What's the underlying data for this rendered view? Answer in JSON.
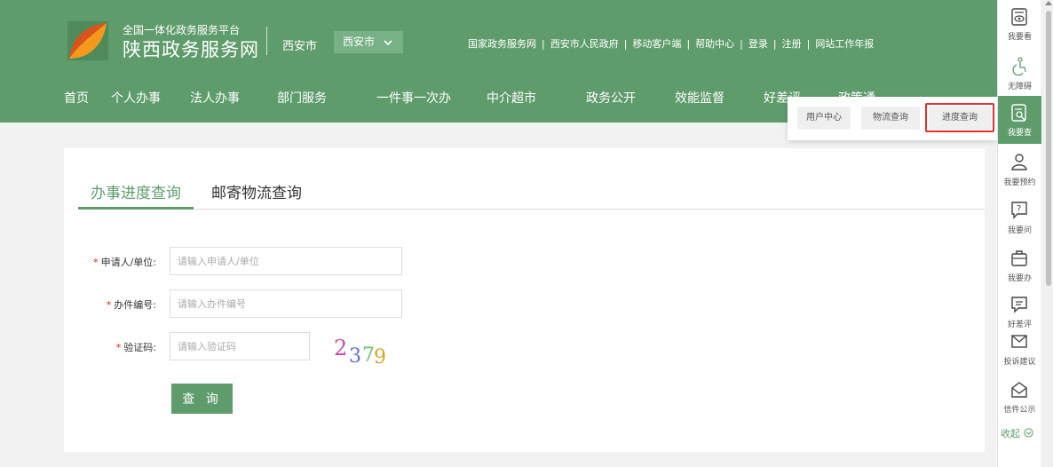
{
  "header": {
    "brand_top": "全国一体化政务服务平台",
    "brand_main": "陕西政务服务网",
    "city": "西安市",
    "city_select": "西安市",
    "top_links": [
      "国家政务服务网",
      "西安市人民政府",
      "移动客户端",
      "帮助中心",
      "登录",
      "注册",
      "网站工作年报"
    ],
    "pipe": "|"
  },
  "nav": {
    "items": [
      "首页",
      "个人办事",
      "法人办事",
      "部门服务",
      "一件事一次办",
      "中介超市",
      "政务公开",
      "效能监督",
      "好差评",
      "政策通"
    ]
  },
  "dropdown": {
    "items": [
      "用户中心",
      "物流查询",
      "进度查询"
    ]
  },
  "tabs": {
    "items": [
      "办事进度查询",
      "邮寄物流查询"
    ],
    "active_index": 0
  },
  "form": {
    "required_mark": "*",
    "applicant_label": "申请人/单位:",
    "applicant_placeholder": "请输入申请人/单位",
    "case_no_label": "办件编号:",
    "case_no_placeholder": "请输入办件编号",
    "captcha_label": "验证码:",
    "captcha_placeholder": "请输入验证码",
    "captcha_code": "2379",
    "submit_label": "查 询"
  },
  "sidebar": {
    "items": [
      {
        "label": "我要看",
        "icon": "eye-icon"
      },
      {
        "label": "无障碍",
        "icon": "accessibility-icon"
      },
      {
        "label": "我要查",
        "icon": "search-doc-icon"
      },
      {
        "label": "我要预约",
        "icon": "person-icon"
      },
      {
        "label": "我要问",
        "icon": "question-icon"
      },
      {
        "label": "我要办",
        "icon": "briefcase-icon"
      },
      {
        "label": "好差评",
        "icon": "comment-icon"
      },
      {
        "label": "投诉建议",
        "icon": "mail-icon"
      },
      {
        "label": "信件公示",
        "icon": "open-mail-icon"
      }
    ],
    "active_index": 2,
    "collapse_label": "收起"
  },
  "colors": {
    "primary_green": "#5f9c6c",
    "highlight_red": "#e03030",
    "required_red": "#e02020"
  }
}
